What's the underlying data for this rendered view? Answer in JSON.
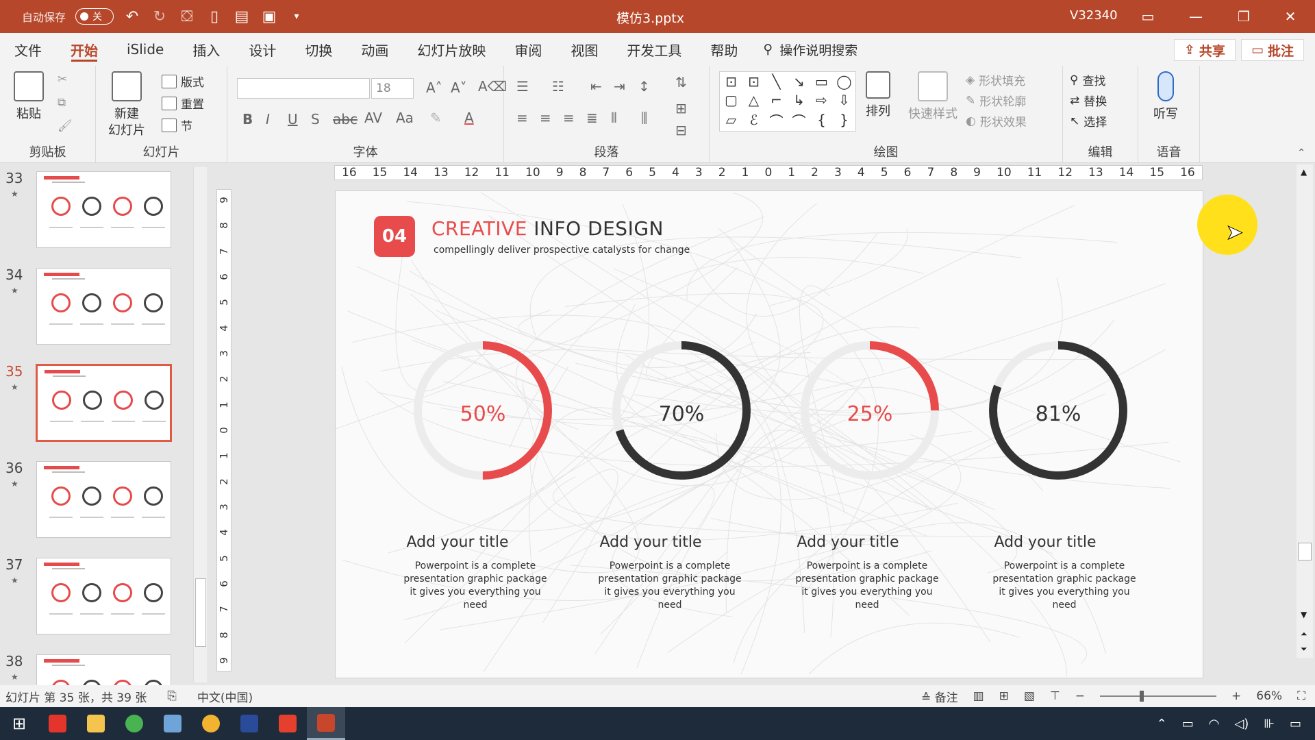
{
  "titlebar": {
    "autosave_label": "自动保存",
    "autosave_state": "关",
    "document_title": "模仿3.pptx",
    "user": "V32340",
    "color": "#b7472a"
  },
  "tabs": [
    "文件",
    "开始",
    "iSlide",
    "插入",
    "设计",
    "切换",
    "动画",
    "幻灯片放映",
    "审阅",
    "视图",
    "开发工具",
    "帮助"
  ],
  "active_tab": "开始",
  "search": {
    "label": "操作说明搜索"
  },
  "share_label": "共享",
  "comment_label": "批注",
  "ribbon": {
    "clipboard": {
      "paste": "粘贴",
      "label": "剪贴板"
    },
    "slides": {
      "new_slide": "新建",
      "new_slide2": "幻灯片",
      "layout": "版式",
      "reset": "重置",
      "section": "节",
      "label": "幻灯片"
    },
    "font": {
      "size": "18",
      "label": "字体"
    },
    "paragraph": {
      "label": "段落"
    },
    "drawing": {
      "arrange": "排列",
      "quick_styles": "快速样式",
      "fill": "形状填充",
      "outline": "形状轮廓",
      "effects": "形状效果",
      "label": "绘图"
    },
    "editing": {
      "find": "查找",
      "replace": "替换",
      "select": "选择",
      "label": "编辑"
    },
    "voice": {
      "dictate": "听写",
      "label": "语音"
    }
  },
  "thumbnails": [
    {
      "num": "33"
    },
    {
      "num": "34"
    },
    {
      "num": "35",
      "active": true
    },
    {
      "num": "36"
    },
    {
      "num": "37"
    },
    {
      "num": "38"
    }
  ],
  "ruler_h": [
    "16",
    "15",
    "14",
    "13",
    "12",
    "11",
    "10",
    "9",
    "8",
    "7",
    "6",
    "5",
    "4",
    "3",
    "2",
    "1",
    "0",
    "1",
    "2",
    "3",
    "4",
    "5",
    "6",
    "7",
    "8",
    "9",
    "10",
    "11",
    "12",
    "13",
    "14",
    "15",
    "16"
  ],
  "ruler_v": [
    "9",
    "8",
    "7",
    "6",
    "5",
    "4",
    "3",
    "2",
    "1",
    "0",
    "1",
    "2",
    "3",
    "4",
    "5",
    "6",
    "7",
    "8",
    "9"
  ],
  "slide": {
    "badge": "04",
    "title_accent": "CREATIVE",
    "title_rest": " INFO DESIGN",
    "subtitle": "compellingly deliver prospective catalysts for change",
    "accent_color": "#e84b4b",
    "dark_color": "#333333",
    "track_color": "#ececec",
    "donuts": [
      {
        "label": "50%",
        "value": 0.5,
        "color": "red"
      },
      {
        "label": "70%",
        "value": 0.7,
        "color": "dark"
      },
      {
        "label": "25%",
        "value": 0.25,
        "color": "red"
      },
      {
        "label": "81%",
        "value": 0.81,
        "color": "dark"
      }
    ],
    "cards": [
      {
        "title": "Add your title",
        "body": "Powerpoint is a complete presentation graphic package it gives you everything you need"
      },
      {
        "title": "Add your title",
        "body": "Powerpoint is a complete presentation graphic package it gives you everything you need"
      },
      {
        "title": "Add your title",
        "body": "Powerpoint is a complete presentation graphic package it gives you everything you need"
      },
      {
        "title": "Add your title",
        "body": "Powerpoint is a complete presentation graphic package it gives you everything you need"
      }
    ]
  },
  "status": {
    "slide_info": "幻灯片 第 35 张，共 39 张",
    "language": "中文(中国)",
    "notes": "备注",
    "zoom": "66%"
  }
}
